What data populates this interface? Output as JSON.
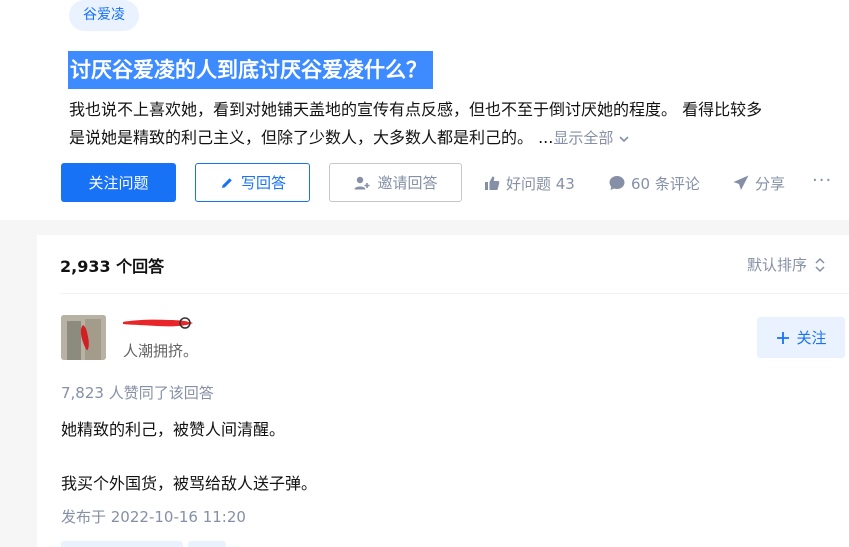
{
  "question": {
    "topic": "谷爱凌",
    "title": "讨厌谷爱凌的人到底讨厌谷爱凌什么？",
    "excerpt_line1": "我也说不上喜欢她，看到对她铺天盖地的宣传有点反感，但也不至于倒讨厌她的程度。 看得比较多",
    "excerpt_line2": "是说她是精致的利己主义，但除了少数人，大多数人都是利己的。 ...",
    "show_all": "显示全部"
  },
  "actions": {
    "follow_question": "关注问题",
    "write_answer": "写回答",
    "invite_answer": "邀请回答",
    "good_question": "好问题 43",
    "comments": "60 条评论",
    "share": "分享",
    "more": "···"
  },
  "answers": {
    "count": "2,933 个回答",
    "sort": "默认排序"
  },
  "answer": {
    "author_bio": "人潮拥挤。",
    "follow": "关注",
    "vote_summary": "7,823 人赞同了该回答",
    "paragraph1": "她精致的利己，被赞人间清醒。",
    "paragraph2": "我买个外国货，被骂给敌人送子弹。",
    "published": "发布于 2022-10-16 11:20"
  },
  "colors": {
    "brand_blue": "#1772f6",
    "title_highlight": "#3d8bff",
    "muted_text": "#8590a6",
    "redaction_red": "#e8262a"
  }
}
